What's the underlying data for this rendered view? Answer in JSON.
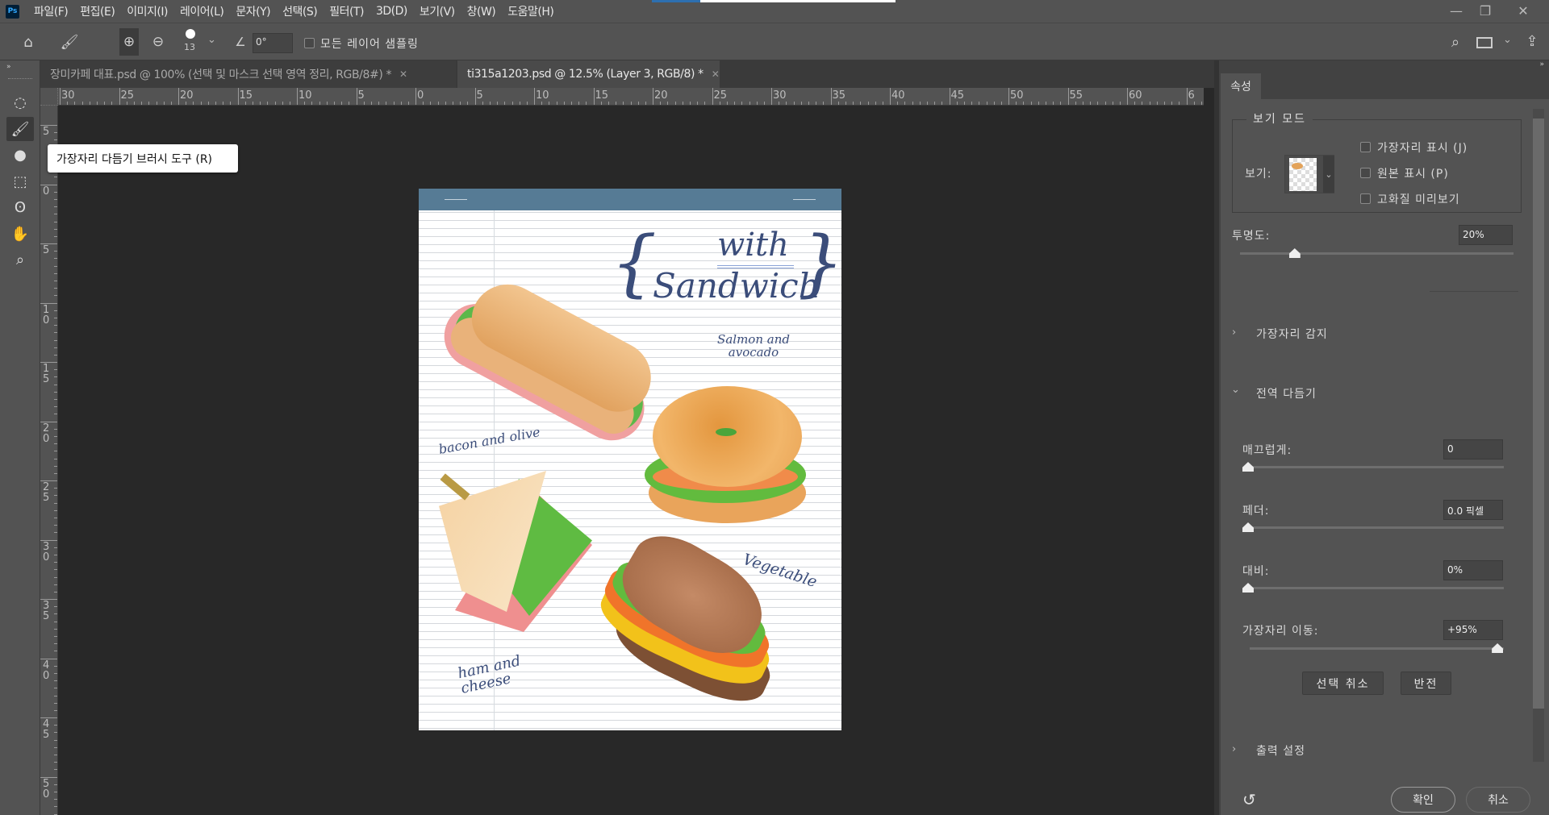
{
  "app": {
    "logo": "Ps"
  },
  "menu": [
    "파일(F)",
    "편집(E)",
    "이미지(I)",
    "레이어(L)",
    "문자(Y)",
    "선택(S)",
    "필터(T)",
    "3D(D)",
    "보기(V)",
    "창(W)",
    "도움말(H)"
  ],
  "window_controls": {
    "minimize": "—",
    "restore": "❐",
    "close": "✕"
  },
  "options": {
    "brush_size": "13",
    "angle": "0°",
    "sample_all_layers_label": "모든 레이어 샘플링",
    "sample_all_layers_checked": false
  },
  "tabs": [
    {
      "label": "장미카페 대표.psd @ 100% (선택 및 마스크  선택 영역 정리, RGB/8#) *",
      "active": false
    },
    {
      "label": "ti315a1203.psd @ 12.5% (Layer 3, RGB/8) *",
      "active": true
    }
  ],
  "tooltip": "가장자리 다듬기 브러시 도구 (R)",
  "ruler": {
    "top": [
      "30",
      "25",
      "20",
      "15",
      "10",
      "5",
      "0",
      "5",
      "10",
      "15",
      "20",
      "25",
      "30",
      "35",
      "40",
      "45",
      "50",
      "55",
      "60",
      "6"
    ],
    "left": [
      "5",
      "0",
      "5",
      "1 0",
      "1 5",
      "2 0",
      "2 5",
      "3 0",
      "3 5",
      "4 0",
      "4 5",
      "5 0"
    ]
  },
  "artwork": {
    "title_line1": "with",
    "title_line2": "Sandwich",
    "labels": {
      "salmon": "Salmon and avocado",
      "bacon": "bacon and olive",
      "ham": "ham and cheese",
      "vegetable": "Vegetable"
    },
    "colors": {
      "header": "#567b95",
      "ink": "#3b4d7a"
    }
  },
  "panel": {
    "tab": "속성",
    "view_mode": {
      "legend": "보기 모드",
      "view_label": "보기:",
      "checkboxes": [
        {
          "label": "가장자리 표시 (J)",
          "checked": false
        },
        {
          "label": "원본 표시 (P)",
          "checked": false
        },
        {
          "label": "고화질 미리보기",
          "checked": false
        }
      ]
    },
    "opacity": {
      "label": "투명도:",
      "value": "20%",
      "fraction": 0.2
    },
    "edge_detection": {
      "label": "가장자리 감지",
      "expanded": false
    },
    "global_refinements": {
      "label": "전역 다듬기",
      "expanded": true,
      "smooth": {
        "label": "매끄럽게:",
        "value": "0",
        "fraction": 0
      },
      "feather": {
        "label": "페더:",
        "value": "0.0 픽셀",
        "fraction": 0
      },
      "contrast": {
        "label": "대비:",
        "value": "0%",
        "fraction": 0
      },
      "shift_edge": {
        "label": "가장자리 이동:",
        "value": "+95%",
        "fraction": 0.975
      },
      "clear_selection": "선택 취소",
      "invert": "반전"
    },
    "output_settings": {
      "label": "출력 설정",
      "expanded": false
    },
    "ok": "확인",
    "cancel": "취소"
  }
}
